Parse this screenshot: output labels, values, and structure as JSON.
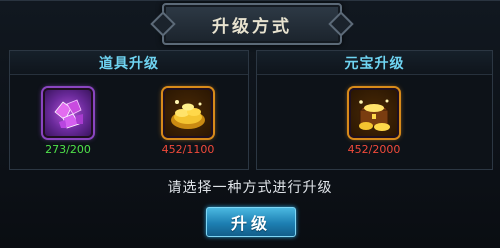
{
  "dialog": {
    "title": "升级方式"
  },
  "panels": {
    "item_upgrade": {
      "title": "道具升级",
      "items": [
        {
          "icon": "purple-gems-icon",
          "count": "273/200",
          "status_color": "#4fe04a"
        },
        {
          "icon": "gold-ingots-icon",
          "count": "452/1100",
          "status_color": "#f04a3a"
        }
      ]
    },
    "yuanbao_upgrade": {
      "title": "元宝升级",
      "items": [
        {
          "icon": "treasure-chest-icon",
          "count": "452/2000",
          "status_color": "#f04a3a"
        }
      ]
    }
  },
  "hint": "请选择一种方式进行升级",
  "upgrade_button": {
    "label": "升级"
  },
  "colors": {
    "accent": "#6fd4f2",
    "button": "#1d7fb2"
  }
}
